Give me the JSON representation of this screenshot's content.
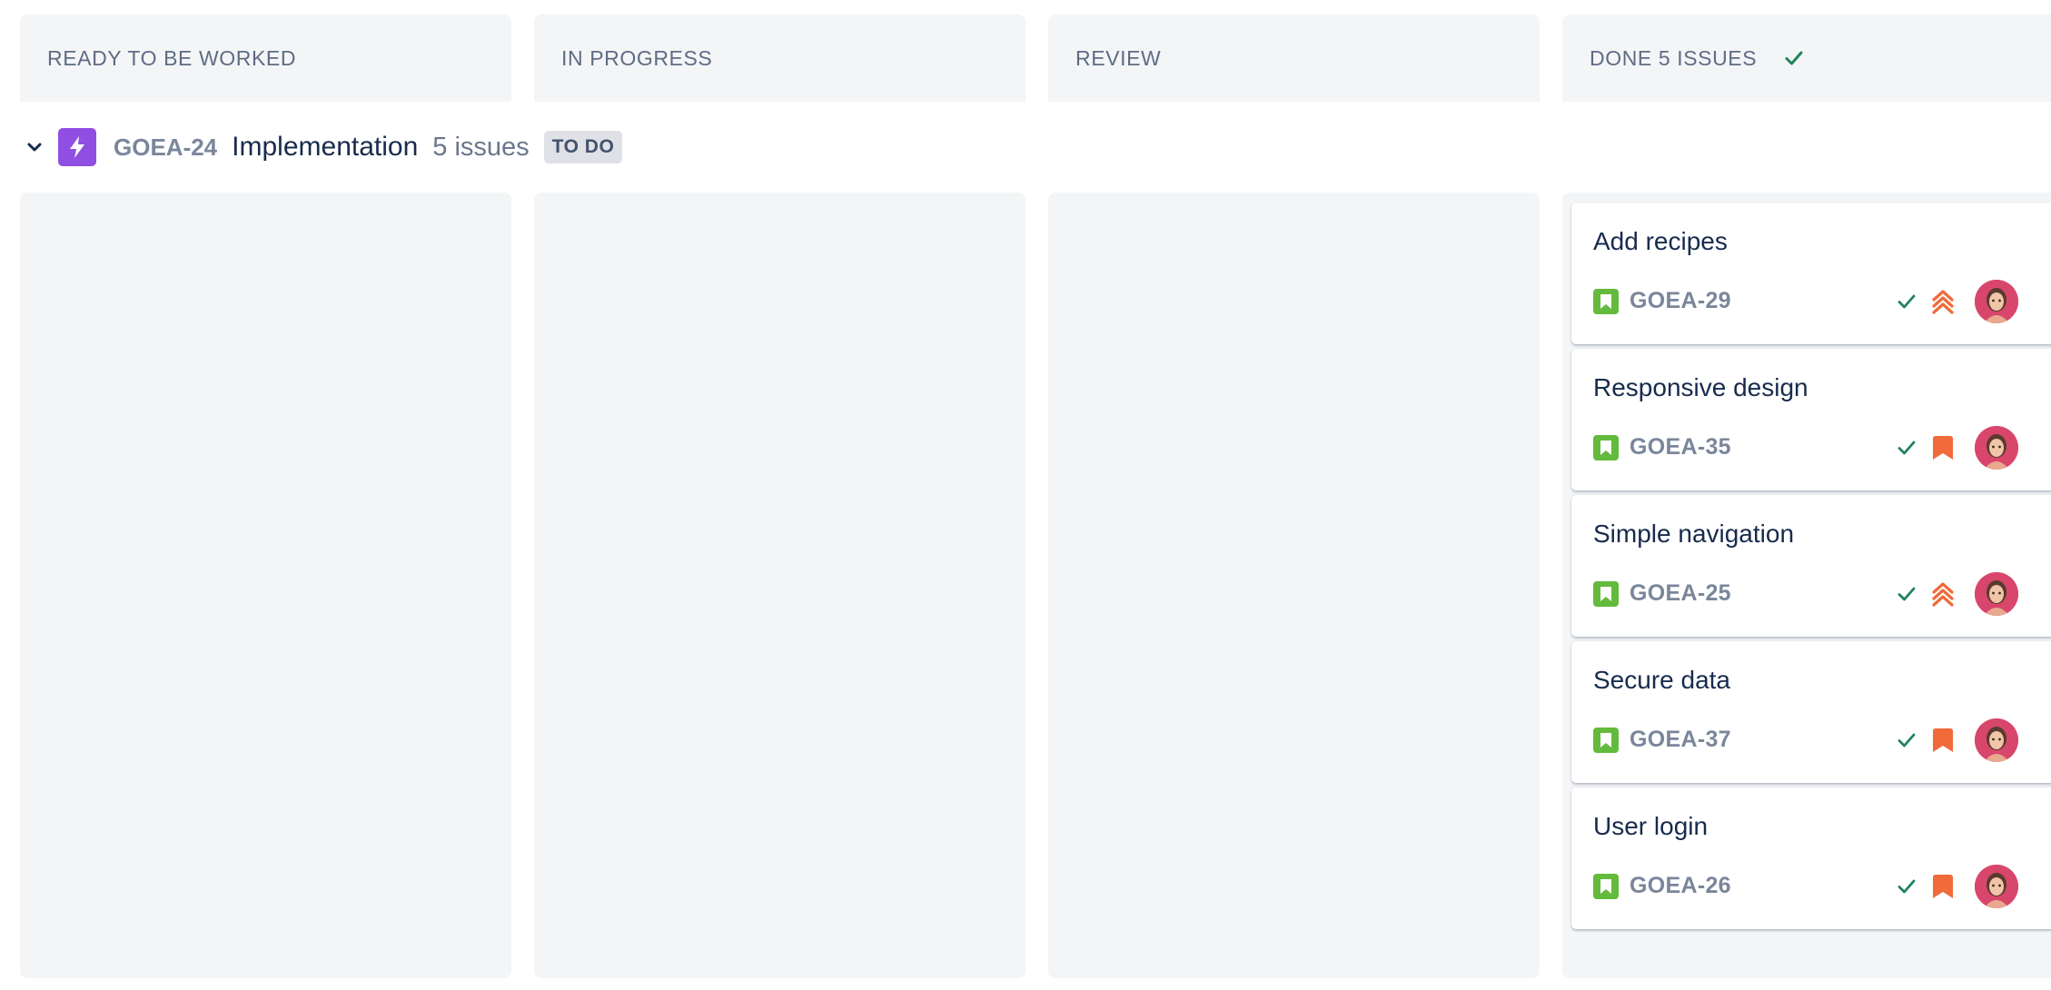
{
  "columns": [
    {
      "title": "READY TO BE WORKED"
    },
    {
      "title": "IN PROGRESS"
    },
    {
      "title": "REVIEW"
    },
    {
      "title": "DONE 5 ISSUES"
    }
  ],
  "swimlane": {
    "epic_key": "GOEA-24",
    "epic_name": "Implementation",
    "issue_count": "5 issues",
    "status": "TO DO",
    "icon": "epic-lightning-icon"
  },
  "cards": [
    {
      "summary": "Add recipes",
      "key": "GOEA-29",
      "priority": "high",
      "priority_icon": "priority-high-icon",
      "resolved_icon": "check-icon"
    },
    {
      "summary": "Responsive design",
      "key": "GOEA-35",
      "priority": "medium",
      "priority_icon": "priority-medium-icon",
      "resolved_icon": "check-icon"
    },
    {
      "summary": "Simple navigation",
      "key": "GOEA-25",
      "priority": "high",
      "priority_icon": "priority-high-icon",
      "resolved_icon": "check-icon"
    },
    {
      "summary": "Secure data",
      "key": "GOEA-37",
      "priority": "medium",
      "priority_icon": "priority-medium-icon",
      "resolved_icon": "check-icon"
    },
    {
      "summary": "User login",
      "key": "GOEA-26",
      "priority": "medium",
      "priority_icon": "priority-medium-icon",
      "resolved_icon": "check-icon"
    }
  ],
  "colors": {
    "epic": "#904ee2",
    "story": "#63ba3c",
    "check": "#36b37e",
    "priority": "#f06a3a",
    "column_bg": "#f4f5f7"
  }
}
